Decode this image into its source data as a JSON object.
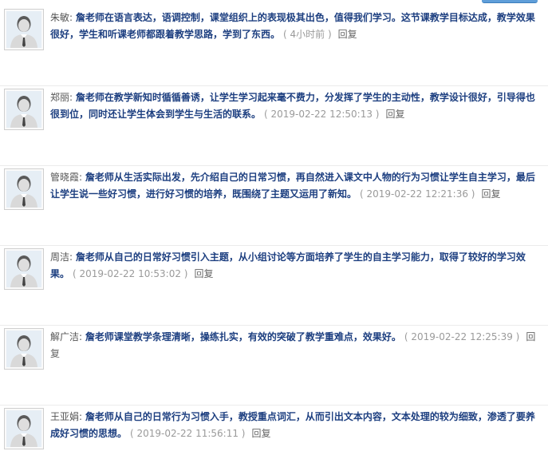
{
  "comments": [
    {
      "name": "朱敏:",
      "content": "詹老师在语言表达，语调控制，课堂组织上的表现极其出色，值得我们学习。这节课教学目标达成，教学效果很好，学生和听课老师都跟着教学思路，学到了东西。",
      "time": "( 4小时前 )",
      "reply": "回复"
    },
    {
      "name": "郑丽:",
      "content": "詹老师在教学新知时循循善诱，让学生学习起来毫不费力，分发挥了学生的主动性，教学设计很好，引导得也很到位，同时还让学生体会到学生与生活的联系。",
      "time": "( 2019-02-22 12:50:13 )",
      "reply": "回复"
    },
    {
      "name": "管晓霞:",
      "content": "詹老师从生活实际出发，先介绍自己的日常习惯，再自然进入课文中人物的行为习惯让学生自主学习，最后让学生说一些好习惯，进行好习惯的培养，既围绕了主题又运用了新知。",
      "time": "( 2019-02-22 12:21:36 )",
      "reply": "回复"
    },
    {
      "name": "周洁:",
      "content": "詹老师从自己的日常好习惯引入主题，从小组讨论等方面培养了学生的自主学习能力，取得了较好的学习效果。",
      "time": "( 2019-02-22 10:53:02 )",
      "reply": "回复"
    },
    {
      "name": "解广洁:",
      "content": "詹老师课堂教学条理清晰，操练扎实，有效的突破了教学重难点，效果好。",
      "time": "( 2019-02-22 12:25:39 )",
      "reply": "回复"
    },
    {
      "name": "王亚娟:",
      "content": "詹老师从自己的日常行为习惯入手，教授重点词汇，从而引出文本内容，文本处理的较为细致，渗透了要养成好习惯的思想。",
      "time": "( 2019-02-22 11:56:11 )",
      "reply": "回复"
    }
  ],
  "colors": {
    "content": "#1d3f80",
    "time": "#9a9a9a",
    "tab": "#5f9ed9"
  },
  "icons": {
    "avatar": "default-user-avatar-icon"
  }
}
